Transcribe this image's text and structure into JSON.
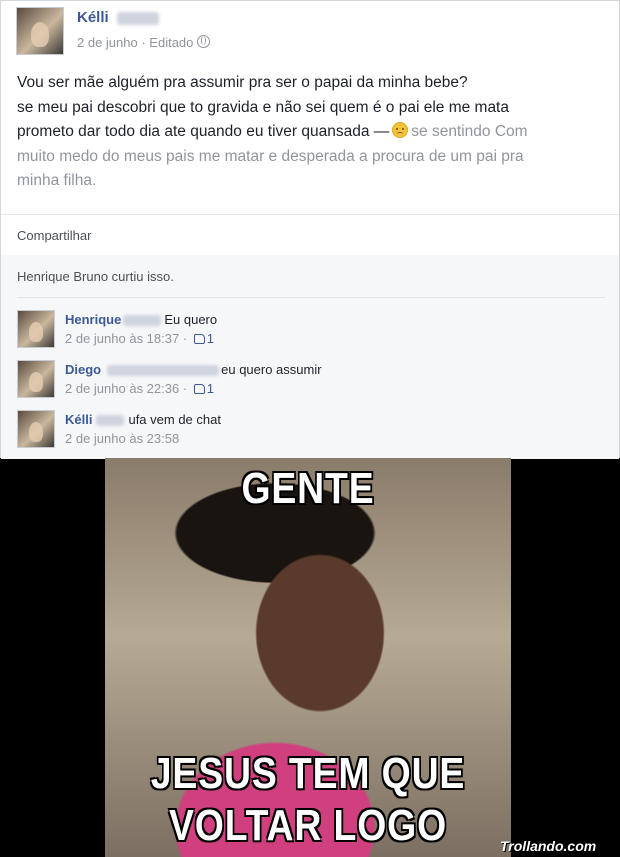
{
  "post": {
    "author": "Kélli",
    "date": "2 de junho",
    "edited": " · Editado",
    "lines": [
      "Vou ser mãe alguém pra assumir pra ser o papai da minha bebe?",
      "se meu pai descobri que to gravida e não sei quem é o pai ele me mata",
      "prometo dar todo dia ate quando eu tiver quansada —"
    ],
    "feeling_prefix": "se sentindo Com",
    "feeling_rest": "muito medo do meus pais me matar e desperada a procura de um pai pra",
    "feeling_end": "minha filha."
  },
  "actions": {
    "share": "Compartilhar"
  },
  "likes_text": "Henrique Bruno curtiu isso.",
  "comments": [
    {
      "name": "Henrique",
      "text": "Eu quero",
      "time": "2 de junho às 18:37",
      "likes": "1"
    },
    {
      "name": "Diego",
      "text": "eu quero assumir",
      "time": "2 de junho às 22:36",
      "likes": "1"
    },
    {
      "name": "Kélli",
      "text": "ufa vem de chat",
      "time": "2 de junho às 23:58"
    }
  ],
  "meme": {
    "top": "GENTE",
    "bottom_line1": "JESUS TEM QUE",
    "bottom_line2": "VOLTAR LOGO",
    "watermark": "Trollando.com"
  }
}
